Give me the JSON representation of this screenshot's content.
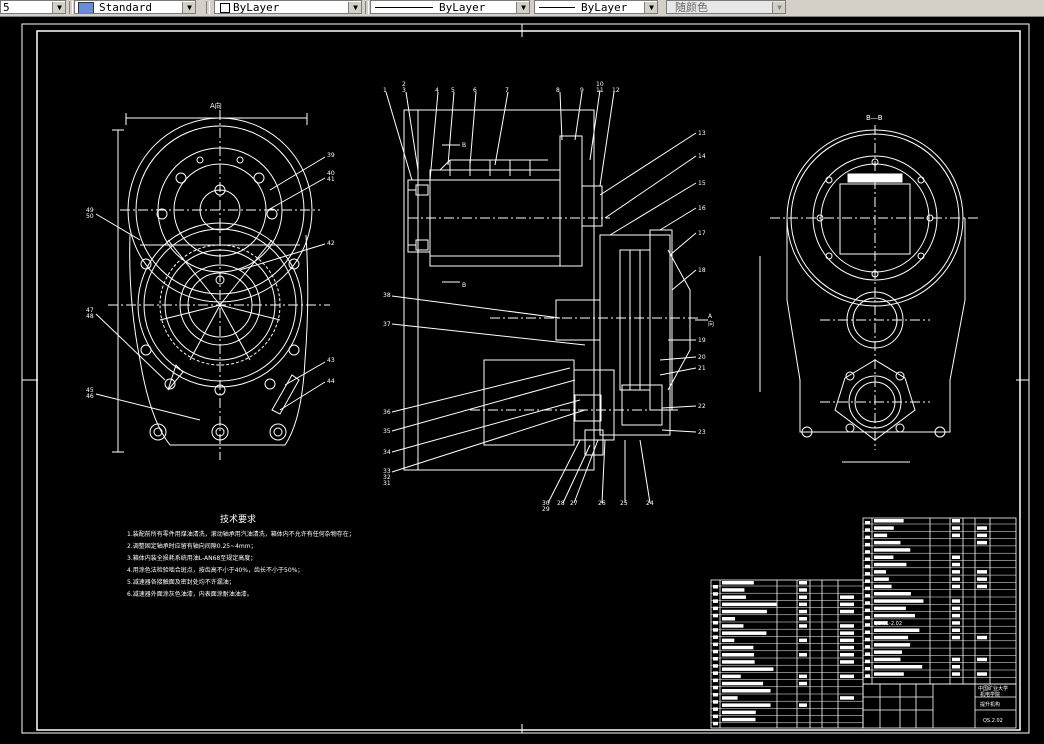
{
  "toolbar": {
    "layer_stub": "5",
    "text_style": "Standard",
    "layer_name": "ByLayer",
    "linetype": "ByLayer",
    "lineweight": "ByLayer",
    "color": "随颜色"
  },
  "drawing": {
    "section_label_aa": "A向",
    "section_label_bb": "B—B",
    "view_mark_b_top": "B",
    "view_mark_b_bottom": "B",
    "view_mark_a": "A",
    "view_mark_dir": "向",
    "callouts_top": [
      "1",
      "2",
      "3",
      "4",
      "5",
      "6",
      "7",
      "8",
      "9",
      "10",
      "11",
      "12"
    ],
    "callouts_right": [
      "13",
      "14",
      "15",
      "16",
      "17",
      "18",
      "19",
      "20",
      "21",
      "22",
      "23"
    ],
    "callouts_left": [
      "38",
      "37",
      "36",
      "35",
      "34",
      "33",
      "32",
      "31"
    ],
    "callouts_bottom": [
      "30",
      "29",
      "28",
      "27",
      "26",
      "25",
      "24"
    ],
    "callouts_aview": [
      "39",
      "40",
      "41",
      "42",
      "43",
      "44",
      "45",
      "46",
      "47",
      "48",
      "49",
      "50"
    ],
    "tech_title": "技术要求",
    "tech_lines": [
      "1.装配前所有零件用煤油清洗，滚动轴承用汽油清洗，箱体内不允许有任何杂物存在；",
      "2.调整固定轴承时应留有轴向间隙0.25~4mm；",
      "3.箱体内装全损耗系统用油L-AN68至规定高度；",
      "4.用涂色法检验啮合斑点，按齿高不小于40%，齿长不小于50%；",
      "5.减速器各接触面及密封处均不许漏油；",
      "6.减速器外面涂灰色油漆，内表面涂耐油油漆。"
    ],
    "title_block": {
      "school": "中国矿业大学",
      "dept": "机电学院",
      "part_name": "提升机构",
      "drawing_no": "QS.2.02",
      "material_code": "QS.01-2.02"
    }
  }
}
